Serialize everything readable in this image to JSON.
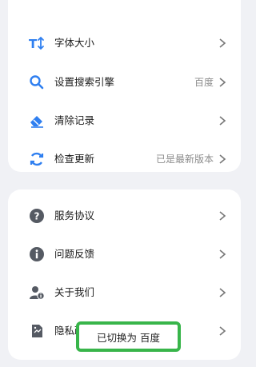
{
  "settings_group_1": {
    "items": [
      {
        "label": "字体大小",
        "value": "",
        "icon": "font-size-icon"
      },
      {
        "label": "设置搜索引擎",
        "value": "百度",
        "icon": "search-icon"
      },
      {
        "label": "清除记录",
        "value": "",
        "icon": "eraser-icon"
      },
      {
        "label": "检查更新",
        "value": "已是最新版本",
        "icon": "refresh-icon"
      }
    ]
  },
  "settings_group_2": {
    "items": [
      {
        "label": "服务协议",
        "value": "",
        "icon": "question-circle-icon"
      },
      {
        "label": "问题反馈",
        "value": "",
        "icon": "info-circle-icon"
      },
      {
        "label": "关于我们",
        "value": "",
        "icon": "user-info-icon"
      },
      {
        "label": "隐私政",
        "value": "",
        "icon": "privacy-document-icon"
      }
    ]
  },
  "toast": {
    "message": "已切换为 百度"
  },
  "colors": {
    "accent_blue": "#2f7ff0",
    "icon_gray": "#555a63",
    "toast_highlight": "#38b54a"
  }
}
